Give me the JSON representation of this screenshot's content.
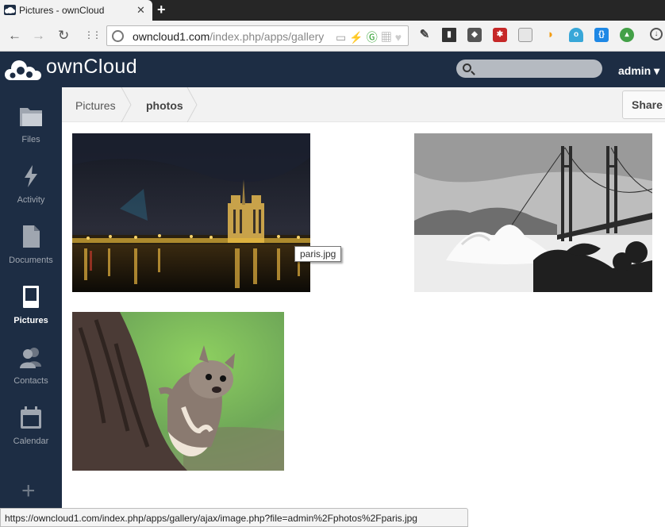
{
  "browser": {
    "tab_title": "Pictures - ownCloud",
    "close_glyph": "✕",
    "new_tab_glyph": "+",
    "back_glyph": "←",
    "forward_glyph": "→",
    "reload_glyph": "↻",
    "apps_glyph": "⋮⋮",
    "url_host": "owncloud1.com",
    "url_path": "/index.php/apps/gallery",
    "status_url": "https://owncloud1.com/index.php/apps/gallery/ajax/image.php?file=admin%2Fphotos%2Fparis.jpg",
    "extensions": [
      "bookmark-icon",
      "evernote-icon",
      "ext-badge-1-icon",
      "window-icon",
      "rss-icon",
      "ghostery-icon",
      "css-icon",
      "green-ext-icon",
      "download-icon"
    ]
  },
  "header": {
    "logo_text": "ownCloud",
    "search_placeholder": "",
    "user": "admin ▾"
  },
  "sidebar": {
    "items": [
      {
        "label": "Files",
        "icon": "folder-icon"
      },
      {
        "label": "Activity",
        "icon": "lightning-icon"
      },
      {
        "label": "Documents",
        "icon": "document-icon"
      },
      {
        "label": "Pictures",
        "icon": "picture-icon",
        "active": true
      },
      {
        "label": "Contacts",
        "icon": "people-icon"
      },
      {
        "label": "Calendar",
        "icon": "calendar-icon"
      }
    ],
    "add_glyph": "+"
  },
  "breadcrumb": {
    "items": [
      "Pictures",
      "photos"
    ]
  },
  "share_label": "Share",
  "gallery": {
    "photos": [
      {
        "name": "paris.jpg",
        "subject": "Notre-Dame at night"
      },
      {
        "name": "golden-gate",
        "subject": "Golden Gate Bridge black and white"
      },
      {
        "name": "squirrel",
        "subject": "Squirrel on tree trunk"
      }
    ],
    "tooltip": "paris.jpg"
  },
  "colors": {
    "header_bg": "#1d2d44",
    "controls_bg": "#f2f2f2"
  }
}
